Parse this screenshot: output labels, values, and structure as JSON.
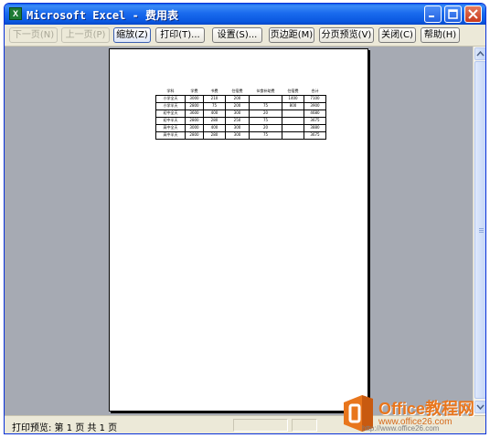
{
  "window": {
    "app_icon_letter": "X",
    "title": "Microsoft Excel - 费用表"
  },
  "toolbar": {
    "next_label": "下一页(N)",
    "prev_label": "上一页(P)",
    "zoom_label": "缩放(Z)",
    "print_label": "打印(T)...",
    "setup_label": "设置(S)...",
    "margins_label": "页边距(M)",
    "page_break_label": "分页预览(V)",
    "close_label": "关闭(C)",
    "help_label": "帮助(H)"
  },
  "sheet": {
    "headers": [
      "学科",
      "学费",
      "书费",
      "住宿费",
      "伙食补助费",
      "住宿费",
      "合计"
    ],
    "rows": [
      [
        "小学全天",
        "3000",
        "210",
        "200",
        "",
        "1400",
        "7100"
      ],
      [
        "小学半天",
        "2800",
        "75",
        "200",
        "75",
        "800",
        "3900"
      ],
      [
        "初中全天",
        "3600",
        "400",
        "300",
        "20",
        "",
        "4680"
      ],
      [
        "初中半天",
        "2800",
        "280",
        "250",
        "75",
        "",
        "3675"
      ],
      [
        "高中全天",
        "3000",
        "400",
        "300",
        "20",
        "",
        "3880"
      ],
      [
        "高中半天",
        "2800",
        "280",
        "300",
        "75",
        "",
        "3675"
      ]
    ]
  },
  "status": {
    "text": "打印预览: 第 1 页  共 1 页"
  },
  "watermark": {
    "title": "Office教程网",
    "url": "www.office26.com",
    "faint_url": "http://www.office26.com"
  },
  "colors": {
    "title_bar": "#0a58e0",
    "workspace": "#a6aab3",
    "watermark_orange": "#e8761d"
  }
}
